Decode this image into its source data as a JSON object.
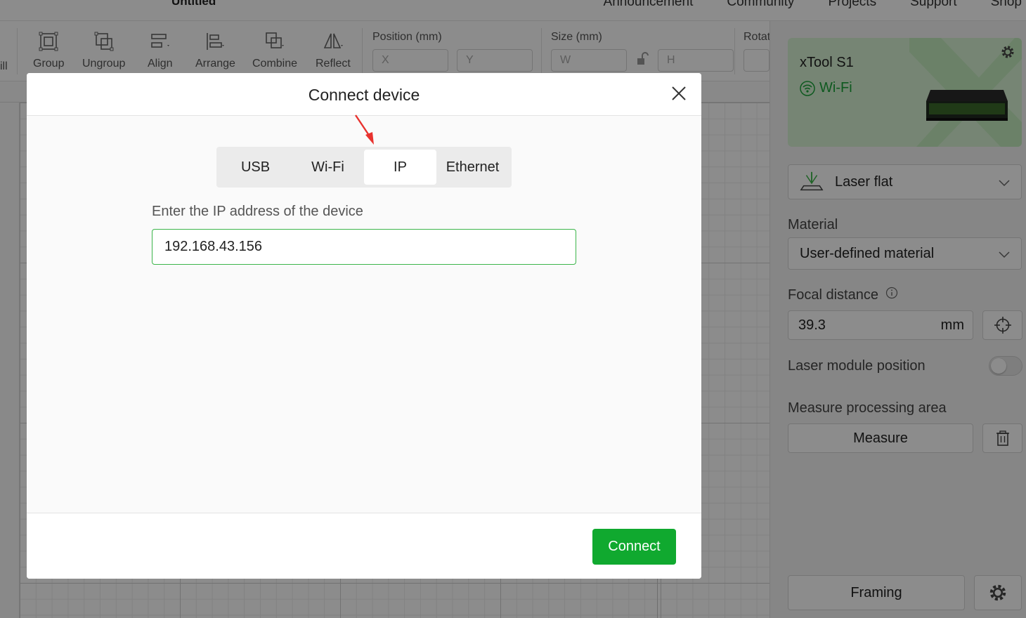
{
  "header": {
    "doc_title": "Untitled",
    "nav": [
      "Announcement",
      "Community",
      "Projects",
      "Support",
      "Shop"
    ]
  },
  "toolbar": {
    "cut_label": "ill",
    "tools": [
      {
        "label": "Group",
        "icon": "group-icon"
      },
      {
        "label": "Ungroup",
        "icon": "ungroup-icon"
      },
      {
        "label": "Align",
        "icon": "align-icon"
      },
      {
        "label": "Arrange",
        "icon": "arrange-icon"
      },
      {
        "label": "Combine",
        "icon": "combine-icon"
      },
      {
        "label": "Reflect",
        "icon": "reflect-icon"
      }
    ],
    "position": {
      "title": "Position (mm)",
      "x_placeholder": "X",
      "y_placeholder": "Y"
    },
    "size": {
      "title": "Size (mm)",
      "w_placeholder": "W",
      "h_placeholder": "H"
    },
    "rotate": {
      "title": "Rotat"
    }
  },
  "panel": {
    "device": {
      "name": "xTool S1",
      "connection": "Wi-Fi",
      "icon": "wifi-icon"
    },
    "mode": {
      "label": "Laser flat",
      "icon": "laser-flat-icon"
    },
    "material": {
      "label": "Material",
      "value": "User-defined material"
    },
    "focal": {
      "label": "Focal distance",
      "value": "39.3",
      "unit": "mm"
    },
    "laser_position": {
      "label": "Laser module position",
      "enabled": false
    },
    "measure": {
      "label": "Measure processing area",
      "button": "Measure"
    },
    "framing_button": "Framing"
  },
  "dialog": {
    "title": "Connect device",
    "tabs": [
      "USB",
      "Wi-Fi",
      "IP",
      "Ethernet"
    ],
    "active_tab": "IP",
    "ip_label": "Enter the IP address of the device",
    "ip_value": "192.168.43.156",
    "connect_button": "Connect"
  },
  "colors": {
    "accent": "#10a92f",
    "input_focus_border": "#3cb54a",
    "wifi_green": "#1aa33a",
    "annotation_arrow": "#e8322e",
    "device_card_bg": "#d8f3d4"
  }
}
